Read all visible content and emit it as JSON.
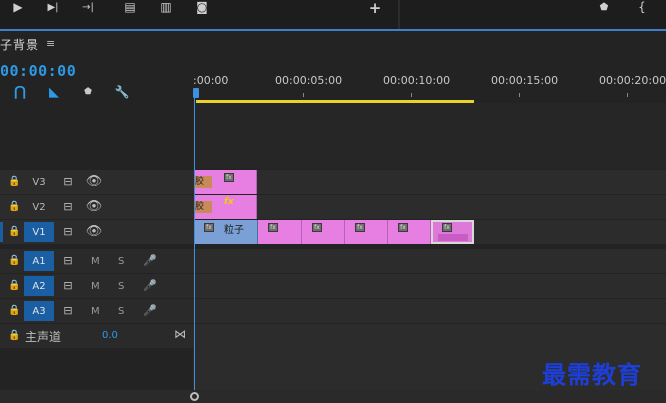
{
  "sequence": {
    "title": "子背景",
    "menu_icon": "≡",
    "timecode": "00:00:00"
  },
  "toolbar_top": {
    "icons": [
      "play-icon",
      "step-forward-icon",
      "trim-icon",
      "lift-icon",
      "extract-icon",
      "camera-icon",
      "add-icon",
      "marker-icon",
      "brace-icon"
    ],
    "glyphs": [
      "▶",
      "▶|",
      "→|",
      "▤",
      "▥",
      "◙",
      "+",
      "⬟",
      "{"
    ]
  },
  "tools": {
    "snap": "⋂",
    "linked": "◣",
    "marker": "⬟",
    "settings": "🔧"
  },
  "ruler": {
    "labels": [
      ":00:00",
      "00:00:05:00",
      "00:00:10:00",
      "00:00:15:00",
      "00:00:20:00"
    ]
  },
  "tracks": {
    "video": [
      {
        "name": "V3",
        "selected": false
      },
      {
        "name": "V2",
        "selected": false
      },
      {
        "name": "V1",
        "selected": true
      }
    ],
    "audio": [
      {
        "name": "A1",
        "m": "M",
        "s": "S"
      },
      {
        "name": "A2",
        "m": "M",
        "s": "S"
      },
      {
        "name": "A3",
        "m": "M",
        "s": "S"
      }
    ],
    "master": {
      "label": "主声道",
      "value": "0.0"
    }
  },
  "clips": {
    "v3_tag": "胶片",
    "v2_tag": "胶片",
    "v1_name": "粒子",
    "fx": "fx"
  },
  "watermark": "最需教育",
  "colors": {
    "accent": "#2d9ae6",
    "clip": "#e77fe3",
    "selected_track": "#1a5ea3",
    "workbar": "#e9d22a"
  }
}
